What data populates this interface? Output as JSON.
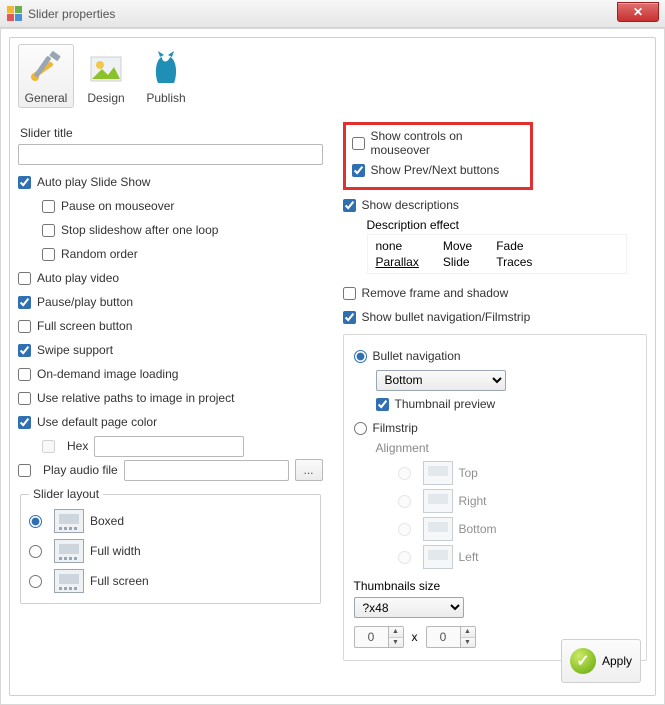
{
  "window": {
    "title": "Slider properties"
  },
  "tabs": {
    "general": "General",
    "design": "Design",
    "publish": "Publish"
  },
  "left": {
    "sliderTitleLabel": "Slider title",
    "sliderTitleValue": "",
    "autoPlaySlideShow": "Auto play Slide Show",
    "pauseOnMouseover": "Pause on mouseover",
    "stopAfterLoop": "Stop slideshow after one loop",
    "randomOrder": "Random order",
    "autoPlayVideo": "Auto play video",
    "pausePlayButton": "Pause/play button",
    "fullScreenButton": "Full screen button",
    "swipeSupport": "Swipe support",
    "onDemandLoading": "On-demand image loading",
    "relativePaths": "Use relative paths to image in project",
    "defaultPageColor": "Use default page color",
    "hexLabel": "Hex",
    "hexValue": "",
    "playAudioFile": "Play audio file",
    "audioPath": "",
    "browse": "...",
    "layout": {
      "legend": "Slider layout",
      "boxed": "Boxed",
      "fullwidth": "Full width",
      "fullscreen": "Full screen"
    }
  },
  "right": {
    "showControlsMouseover": "Show controls on mouseover",
    "showPrevNext": "Show Prev/Next buttons",
    "showDescriptions": "Show descriptions",
    "descEffectLabel": "Description effect",
    "descEffects": {
      "r1c1": "none",
      "r1c2": "Move",
      "r1c3": "Fade",
      "r2c1": "Parallax",
      "r2c2": "Slide",
      "r2c3": "Traces"
    },
    "removeFrame": "Remove frame and shadow",
    "bulletNav": "Show bullet navigation/Filmstrip",
    "nav": {
      "bulletLabel": "Bullet navigation",
      "positionSelected": "Bottom",
      "thumbPreview": "Thumbnail preview",
      "filmstripLabel": "Filmstrip",
      "alignmentLabel": "Alignment",
      "alignTop": "Top",
      "alignRight": "Right",
      "alignBottom": "Bottom",
      "alignLeft": "Left",
      "thumbSizeLabel": "Thumbnails size",
      "thumbSizeSelected": "?x48",
      "w": "0",
      "x": "x",
      "h": "0"
    }
  },
  "apply": "Apply"
}
